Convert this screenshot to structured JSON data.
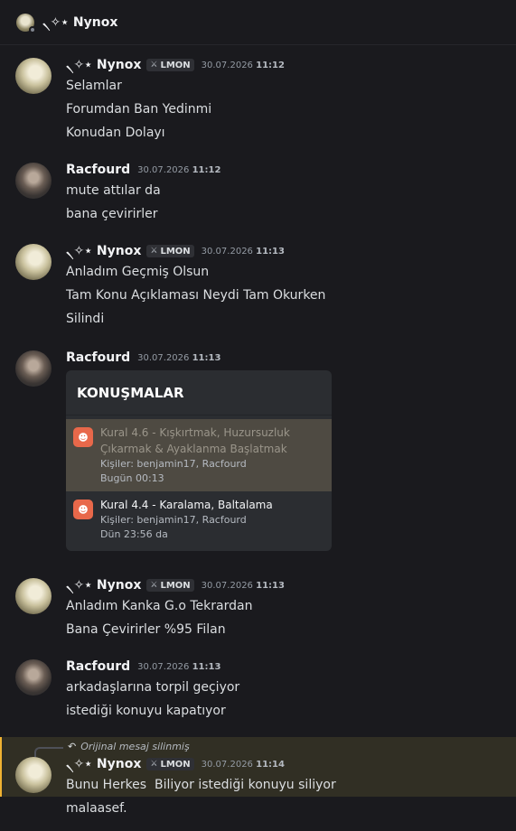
{
  "channel": {
    "title": "৲✧⋆ Nynox"
  },
  "messages": [
    {
      "author": "৲✧⋆ Nynox",
      "tag": "LMON",
      "date": "30.07.2026",
      "time": "11:12",
      "lines": [
        "Selamlar",
        "Forumdan Ban Yedinmi",
        "Konudan Dolayı"
      ]
    },
    {
      "author": "Racfourd",
      "date": "30.07.2026",
      "time": "11:12",
      "lines": [
        "mute attılar da",
        "bana çevirirler"
      ]
    },
    {
      "author": "৲✧⋆ Nynox",
      "tag": "LMON",
      "date": "30.07.2026",
      "time": "11:13",
      "lines": [
        "Anladım Geçmiş Olsun",
        "Tam Konu Açıklaması Neydi Tam Okurken",
        "Silindi"
      ]
    },
    {
      "author": "Racfourd",
      "date": "30.07.2026",
      "time": "11:13",
      "embed": {
        "title": "KONUŞMALAR",
        "rows": [
          {
            "title": "Kural 4.6 - Kışkırtmak, Huzursuzluk Çıkarmak & Ayaklanma Başlatmak",
            "title_line1": "Kural 4.6 - Kışkırtmak, Huzursuzluk",
            "title_line2": "Çıkarmak & Ayaklanma Başlatmak",
            "people": "Kişiler: benjamin17, Racfourd",
            "when": "Bugün 00:13"
          },
          {
            "title": "Kural 4.4 - Karalama, Baltalama",
            "people": "Kişiler: benjamin17, Racfourd",
            "when": "Dün 23:56 da"
          }
        ]
      }
    },
    {
      "author": "৲✧⋆ Nynox",
      "tag": "LMON",
      "date": "30.07.2026",
      "time": "11:13",
      "lines": [
        "Anladım Kanka G.o Tekrardan",
        "Bana Çevirirler %95 Filan"
      ]
    },
    {
      "author": "Racfourd",
      "date": "30.07.2026",
      "time": "11:13",
      "lines": [
        "arkadaşlarına torpil geçiyor",
        "istediği konuyu kapatıyor"
      ]
    },
    {
      "reply_to": "Orijinal mesaj silinmiş",
      "author": "৲✧⋆ Nynox",
      "tag": "LMON",
      "date": "30.07.2026",
      "time": "11:14",
      "lines": [
        "Bunu Herkes  Biliyor istediği konuyu siliyor",
        "malaasef."
      ]
    }
  ],
  "colors": {
    "background": "#1a1a1e",
    "mention_highlight": "#312f24",
    "mention_border": "#f0b232",
    "embed_icon": "#e8684a"
  },
  "icons": {
    "role_tag": "sword-icon",
    "reply": "reply-arrow-icon",
    "embed_row": "ticket-icon"
  }
}
